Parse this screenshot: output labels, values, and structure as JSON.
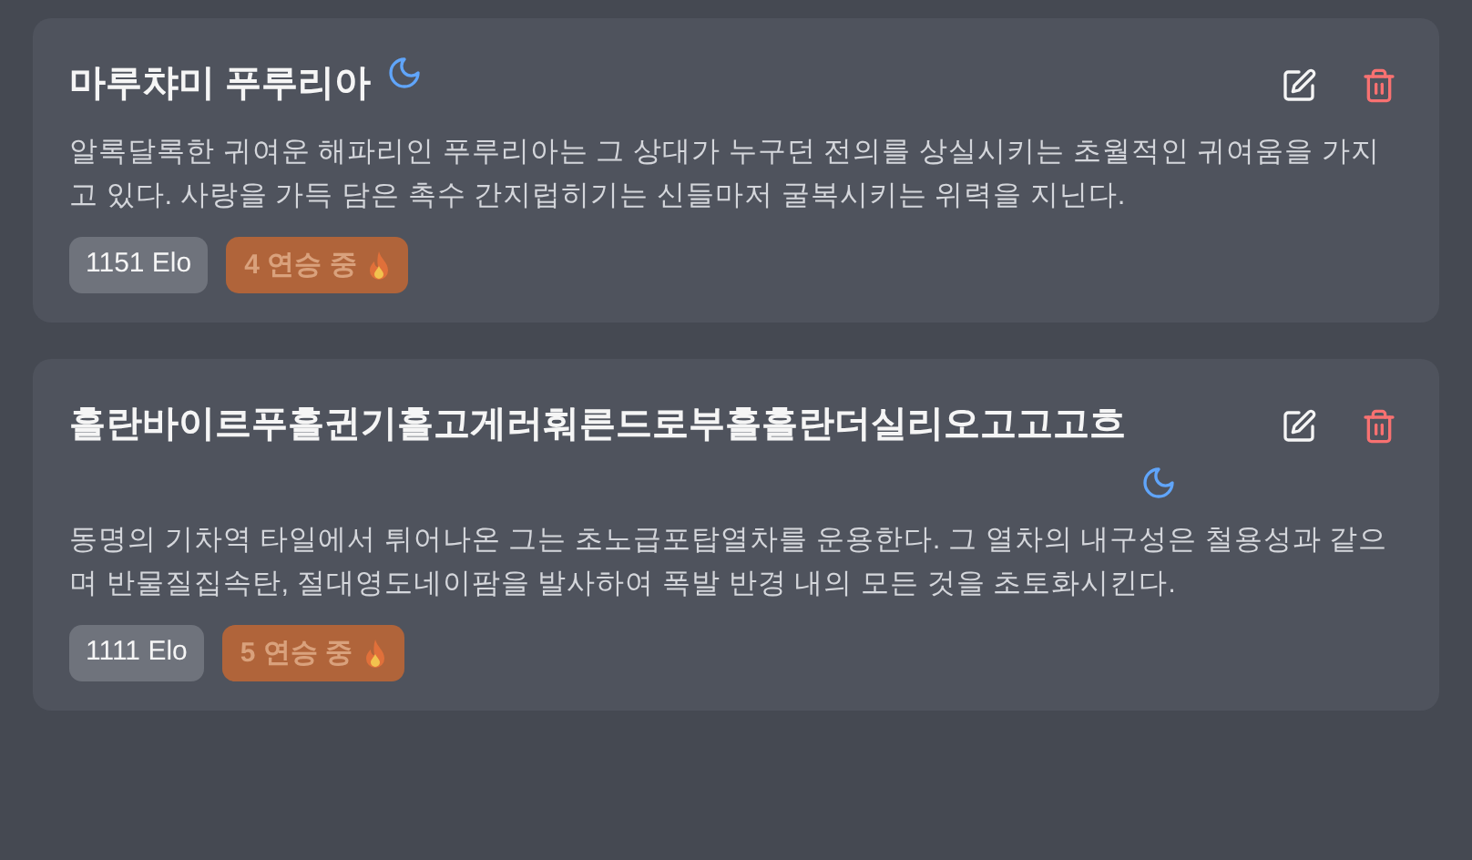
{
  "cards": [
    {
      "title": "마루챠미 푸루리아",
      "description": "알록달록한 귀여운 해파리인 푸루리아는 그 상대가 누구던 전의를 상실시키는 초월적인 귀여움을 가지고 있다. 사랑을 가득 담은 촉수 간지럽히기는 신들마저 굴복시키는 위력을 지닌다.",
      "elo": "1151 Elo",
      "streak": "4 연승 중"
    },
    {
      "title": "흘란바이르푸흘귄기흘고게러훠른드로부흘흘란더실리오고고고흐",
      "description": "동명의 기차역 타일에서 튀어나온 그는 초노급포탑열차를 운용한다. 그 열차의 내구성은 철용성과 같으며 반물질집속탄, 절대영도네이팜을 발사하여 폭발 반경 내의 모든 것을 초토화시킨다.",
      "elo": "1111 Elo",
      "streak": "5 연승 중"
    }
  ]
}
